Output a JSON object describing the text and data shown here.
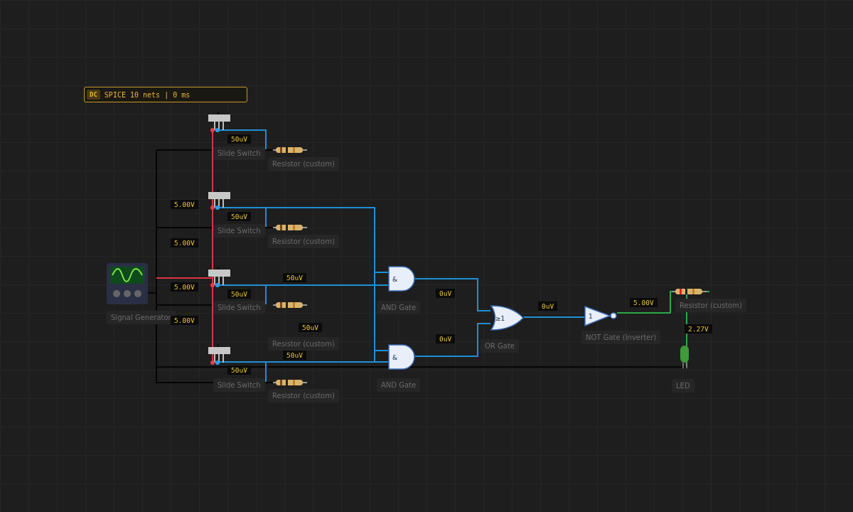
{
  "status": {
    "badge": "DC",
    "text": "SPICE 10 nets | 0 ms"
  },
  "components": [
    {
      "kind": "generator",
      "label": "Signal Generator"
    },
    {
      "kind": "switch",
      "label": "Slide Switch"
    },
    {
      "kind": "switch",
      "label": "Slide Switch"
    },
    {
      "kind": "switch",
      "label": "Slide Switch"
    },
    {
      "kind": "switch",
      "label": "Slide Switch"
    },
    {
      "kind": "resistor",
      "label": "Resistor (custom)"
    },
    {
      "kind": "resistor",
      "label": "Resistor (custom)"
    },
    {
      "kind": "resistor",
      "label": "Resistor (custom)"
    },
    {
      "kind": "resistor",
      "label": "Resistor (custom)"
    },
    {
      "kind": "and",
      "label": "AND Gate",
      "symbol": "&"
    },
    {
      "kind": "and",
      "label": "AND Gate",
      "symbol": "&"
    },
    {
      "kind": "or",
      "label": "OR Gate",
      "symbol": "≥1"
    },
    {
      "kind": "not",
      "label": "NOT Gate (Inverter)",
      "symbol": "1"
    },
    {
      "kind": "resistor",
      "label": "Resistor (custom)"
    },
    {
      "kind": "led",
      "label": "LED"
    }
  ],
  "probes": [
    {
      "reading": "50uV"
    },
    {
      "reading": "5.00V"
    },
    {
      "reading": "50uV"
    },
    {
      "reading": "5.00V"
    },
    {
      "reading": "5.00V"
    },
    {
      "reading": "50uV"
    },
    {
      "reading": "50uV"
    },
    {
      "reading": "50uV"
    },
    {
      "reading": "5.00V"
    },
    {
      "reading": "0uV"
    },
    {
      "reading": "0uV"
    },
    {
      "reading": "0uV"
    },
    {
      "reading": "5.00V"
    },
    {
      "reading": "2.27V"
    },
    {
      "reading": "50uV"
    },
    {
      "reading": "50uV"
    }
  ]
}
